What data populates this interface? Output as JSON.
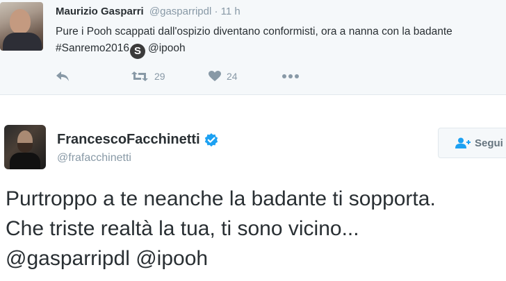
{
  "reply_context": {
    "name": "Maurizio Gasparri",
    "handle": "@gasparripdl",
    "separator": "·",
    "time": "11 h",
    "text_part1": "Pure i Pooh scappati dall'ospizio diventano conformisti, ora a nanna con la badante #Sanremo2016",
    "s_badge": "S",
    "mention": "@ipooh",
    "retweet_count": "29",
    "like_count": "24",
    "colors": {
      "background": "#f5f8fa",
      "meta": "#8899a6"
    }
  },
  "tweet": {
    "name": "FrancescoFacchinetti",
    "handle": "@frafacchinetti",
    "verified": true,
    "follow_label": "Segui",
    "lines": [
      "Purtroppo a te neanche la badante ti sopporta.",
      "Che triste realtà la tua, ti sono vicino...",
      "@gasparripdl @ipooh"
    ],
    "colors": {
      "verified": "#1da1f2",
      "follow_icon": "#1da1f2"
    }
  }
}
